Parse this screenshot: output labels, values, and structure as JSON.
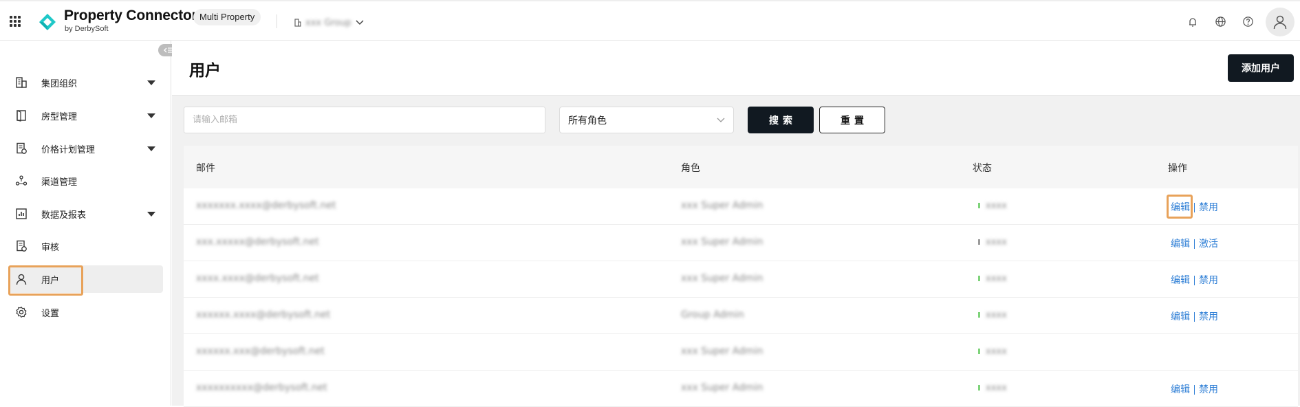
{
  "app": {
    "brand": "Property Connector",
    "brand_sub": "by DerbySoft",
    "mode_badge": "Multi Property",
    "group_selector": "xxx Group"
  },
  "top_icons": [
    "bell-icon",
    "globe-icon",
    "help-icon",
    "user-avatar-icon"
  ],
  "sidebar": {
    "items": [
      {
        "label": "集团组织",
        "icon": "building-icon",
        "expandable": true
      },
      {
        "label": "房型管理",
        "icon": "door-icon",
        "expandable": true
      },
      {
        "label": "价格计划管理",
        "icon": "price-plan-icon",
        "expandable": true
      },
      {
        "label": "渠道管理",
        "icon": "channel-icon",
        "expandable": false
      },
      {
        "label": "数据及报表",
        "icon": "report-icon",
        "expandable": true
      },
      {
        "label": "审核",
        "icon": "audit-icon",
        "expandable": false
      },
      {
        "label": "用户",
        "icon": "user-icon",
        "expandable": false,
        "active": true
      },
      {
        "label": "设置",
        "icon": "settings-icon",
        "expandable": false
      }
    ]
  },
  "page": {
    "title": "用户",
    "add_button": "添加用户"
  },
  "filters": {
    "email_placeholder": "请输入邮箱",
    "role_select_value": "所有角色",
    "search_button": "搜索",
    "reset_button": "重置"
  },
  "table": {
    "columns": [
      "邮件",
      "角色",
      "状态",
      "操作"
    ],
    "rows": [
      {
        "email": "xxxxxxx.xxxx@derbysoft.net",
        "role": "xxx Super Admin",
        "status": "xxxx",
        "status_color": "#7ed37a",
        "actions": [
          "编辑",
          "禁用"
        ]
      },
      {
        "email": "xxx.xxxxx@derbysoft.net",
        "role": "xxx Super Admin",
        "status": "xxxx",
        "status_color": "#9a9a9a",
        "actions": [
          "编辑",
          "激活"
        ]
      },
      {
        "email": "xxxx.xxxx@derbysoft.net",
        "role": "xxx Super Admin",
        "status": "xxxx",
        "status_color": "#7ed37a",
        "actions": [
          "编辑",
          "禁用"
        ]
      },
      {
        "email": "xxxxxx.xxxx@derbysoft.net",
        "role": "Group Admin",
        "status": "xxxx",
        "status_color": "#7ed37a",
        "actions": [
          "编辑",
          "禁用"
        ]
      },
      {
        "email": "xxxxxx.xxx@derbysoft.net",
        "role": "xxx Super Admin",
        "status": "xxxx",
        "status_color": "#7ed37a",
        "actions": []
      },
      {
        "email": "xxxxxxxxxx@derbysoft.net",
        "role": "xxx Super Admin",
        "status": "xxxx",
        "status_color": "#7ed37a",
        "actions": [
          "编辑",
          "禁用"
        ]
      }
    ]
  },
  "colors": {
    "highlight": "#e8a25a",
    "primary_dark": "#111921",
    "link": "#2f7fd6",
    "logo": "#1fc8c8"
  }
}
